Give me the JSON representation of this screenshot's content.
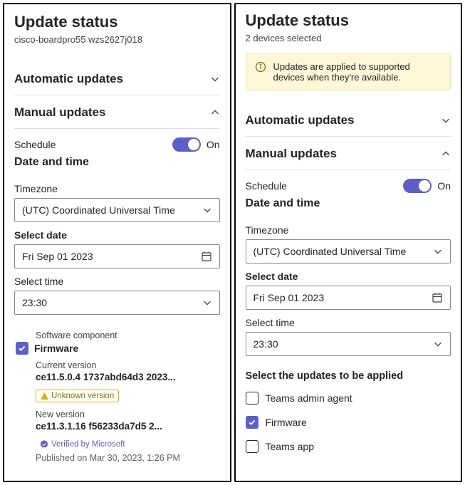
{
  "left": {
    "title": "Update status",
    "subtitle": "cisco-boardpro55 wzs2627j018",
    "automatic": "Automatic updates",
    "manual": "Manual updates",
    "schedule": "Schedule",
    "on": "On",
    "datetime_title": "Date and time",
    "timezone_label": "Timezone",
    "timezone_value": "(UTC) Coordinated Universal Time",
    "date_label": "Select date",
    "date_value": "Fri Sep 01 2023",
    "time_label": "Select time",
    "time_value": "23:30",
    "component_label": "Software component",
    "firmware": "Firmware",
    "curver_label": "Current version",
    "curver_value": "ce11.5.0.4 1737abd64d3 2023...",
    "unknown_badge": "Unknown version",
    "newver_label": "New version",
    "newver_value": "ce11.3.1.16 f56233da7d5 2...",
    "verified_badge": "Verified by Microsoft",
    "published": "Published on Mar 30, 2023, 1:26 PM"
  },
  "right": {
    "title": "Update status",
    "subtitle": "2 devices selected",
    "info": "Updates are applied to supported devices when they're available.",
    "automatic": "Automatic updates",
    "manual": "Manual updates",
    "schedule": "Schedule",
    "on": "On",
    "datetime_title": "Date and time",
    "timezone_label": "Timezone",
    "timezone_value": "(UTC) Coordinated Universal Time",
    "date_label": "Select date",
    "date_value": "Fri Sep 01 2023",
    "time_label": "Select time",
    "time_value": "23:30",
    "updates_title": "Select the updates to be applied",
    "opt1": "Teams admin agent",
    "opt2": "Firmware",
    "opt3": "Teams app"
  }
}
